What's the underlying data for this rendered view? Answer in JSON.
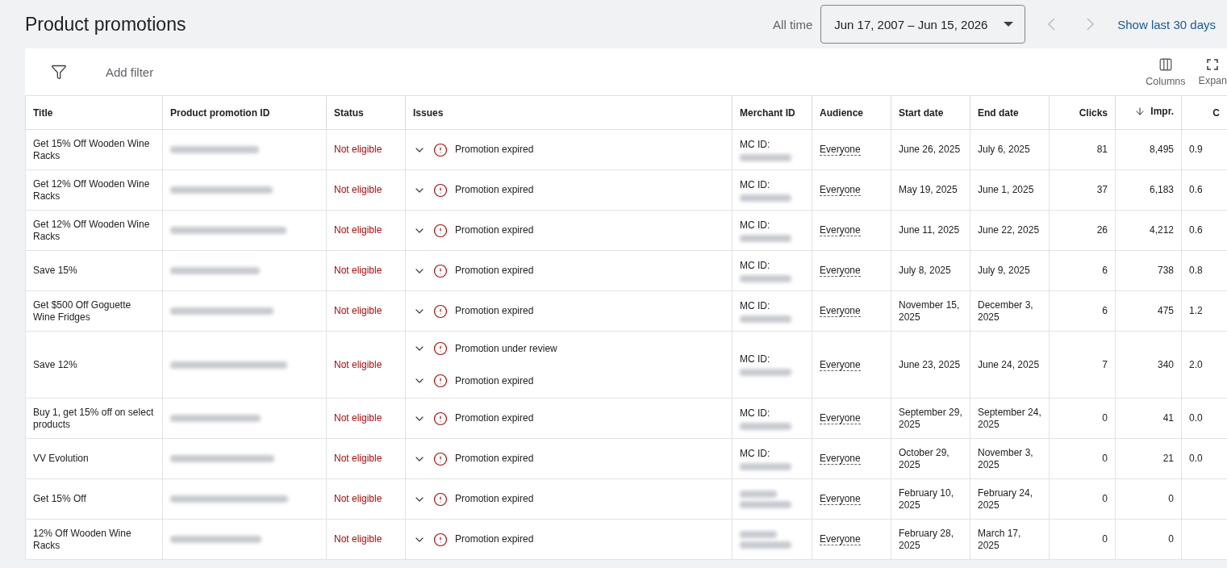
{
  "page_title": "Product promotions",
  "date_range": {
    "label": "All time",
    "value": "Jun 17, 2007 – Jun 15, 2026",
    "prev_disabled": true,
    "next_disabled": true,
    "shortcut": "Show last 30 days"
  },
  "toolbar": {
    "filter_label": "Add filter",
    "actions": [
      {
        "kind": "columns",
        "label": "Columns"
      },
      {
        "kind": "expand",
        "label": "Expan"
      }
    ]
  },
  "table": {
    "columns": [
      {
        "label": "Title",
        "sorted": false
      },
      {
        "label": "Product promotion ID",
        "sorted": false
      },
      {
        "label": "Status",
        "sorted": false
      },
      {
        "label": "Issues",
        "sorted": false
      },
      {
        "label": "Merchant ID",
        "sorted": false
      },
      {
        "label": "Audience",
        "sorted": false
      },
      {
        "label": "Start date",
        "sorted": false
      },
      {
        "label": "End date",
        "sorted": false
      },
      {
        "label": "Clicks",
        "sorted": false
      },
      {
        "label": "Impr.",
        "sorted": true
      },
      {
        "label": "C",
        "sorted": false
      }
    ],
    "rows": [
      {
        "title": "Get 15% Off Wooden Wine Racks",
        "status": "Not eligible",
        "issues": [
          "Promotion expired"
        ],
        "merchant_label": "MC ID:",
        "audience": "Everyone",
        "start": "June 26, 2025",
        "end": "July 6, 2025",
        "clicks": "81",
        "impr": "8,495",
        "column_11": "0.9"
      },
      {
        "title": "Get 12% Off Wooden Wine Racks",
        "status": "Not eligible",
        "issues": [
          "Promotion expired"
        ],
        "merchant_label": "MC ID:",
        "audience": "Everyone",
        "start": "May 19, 2025",
        "end": "June 1, 2025",
        "clicks": "37",
        "impr": "6,183",
        "column_11": "0.6"
      },
      {
        "title": "Get 12% Off Wooden Wine Racks",
        "status": "Not eligible",
        "issues": [
          "Promotion expired"
        ],
        "merchant_label": "MC ID:",
        "audience": "Everyone",
        "start": "June 11, 2025",
        "end": "June 22, 2025",
        "clicks": "26",
        "impr": "4,212",
        "column_11": "0.6"
      },
      {
        "title": "Save 15%",
        "status": "Not eligible",
        "issues": [
          "Promotion expired"
        ],
        "merchant_label": "MC ID:",
        "audience": "Everyone",
        "start": "July 8, 2025",
        "end": "July 9, 2025",
        "clicks": "6",
        "impr": "738",
        "column_11": "0.8"
      },
      {
        "title": "Get $500 Off Goguette Wine Fridges",
        "status": "Not eligible",
        "issues": [
          "Promotion expired"
        ],
        "merchant_label": "MC ID:",
        "audience": "Everyone",
        "start": "November 15, 2025",
        "end": "December 3, 2025",
        "clicks": "6",
        "impr": "475",
        "column_11": "1.2"
      },
      {
        "title": "Save 12%",
        "status": "Not eligible",
        "issues": [
          "Promotion under review",
          "Promotion expired"
        ],
        "merchant_label": "MC ID:",
        "audience": "Everyone",
        "start": "June 23, 2025",
        "end": "June 24, 2025",
        "clicks": "7",
        "impr": "340",
        "column_11": "2.0"
      },
      {
        "title": "Buy 1, get 15% off on select products",
        "status": "Not eligible",
        "issues": [
          "Promotion expired"
        ],
        "merchant_label": "MC ID:",
        "audience": "Everyone",
        "start": "September 29, 2025",
        "end": "September 24, 2025",
        "clicks": "0",
        "impr": "41",
        "column_11": "0.0"
      },
      {
        "title": "VV Evolution",
        "status": "Not eligible",
        "issues": [
          "Promotion expired"
        ],
        "merchant_label": "MC ID:",
        "audience": "Everyone",
        "start": "October 29, 2025",
        "end": "November 3, 2025",
        "clicks": "0",
        "impr": "21",
        "column_11": "0.0"
      },
      {
        "title": "Get 15% Off",
        "status": "Not eligible",
        "issues": [
          "Promotion expired"
        ],
        "audience": "Everyone",
        "start": "February 10, 2025",
        "end": "February 24, 2025",
        "clicks": "0",
        "impr": "0"
      },
      {
        "title": "12% Off Wooden Wine Racks",
        "status": "Not eligible",
        "issues": [
          "Promotion expired"
        ],
        "audience": "Everyone",
        "start": "February 28, 2025",
        "end": "March 17, 2025",
        "clicks": "0",
        "impr": "0"
      }
    ]
  }
}
